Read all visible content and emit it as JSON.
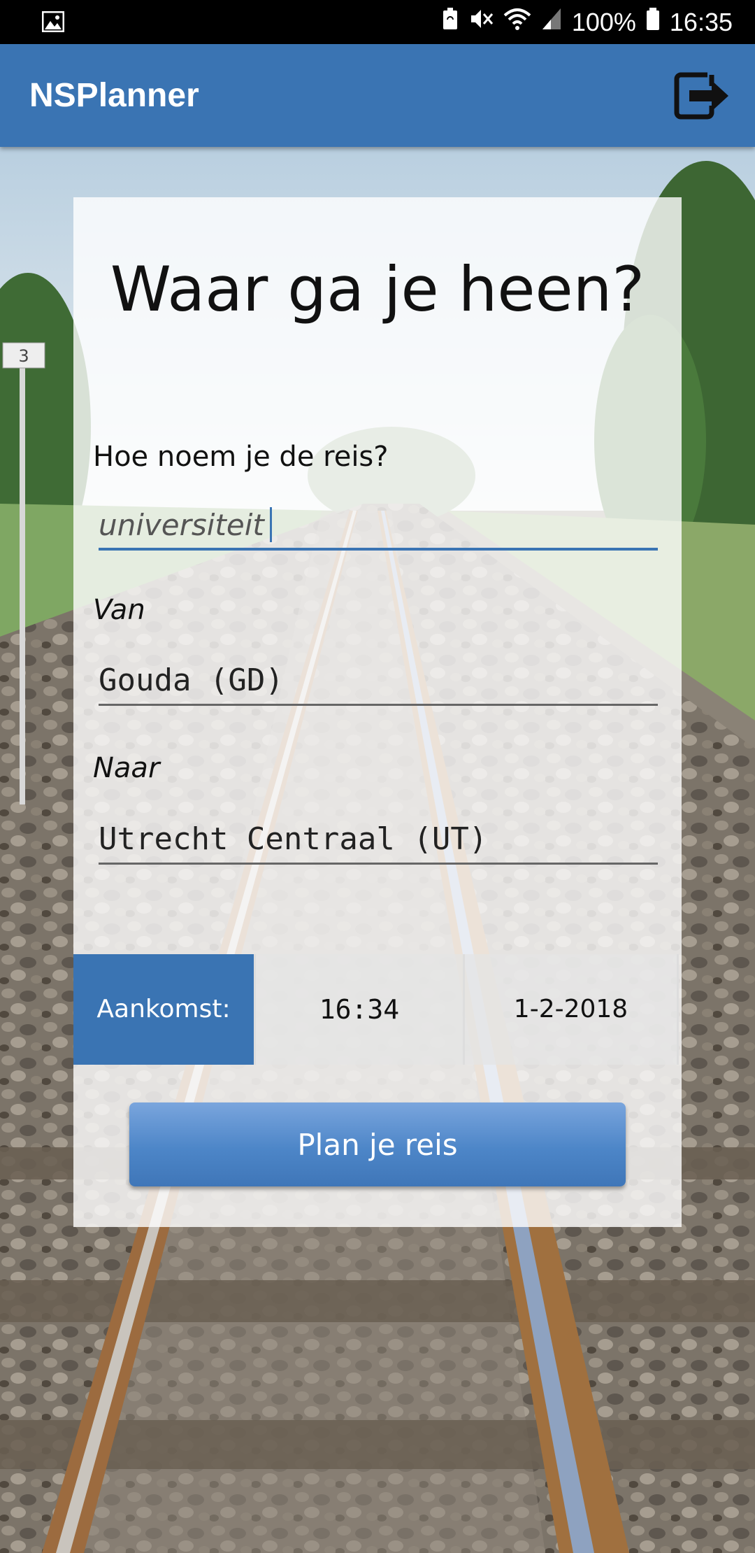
{
  "status_bar": {
    "battery_percent": "100%",
    "time": "16:35",
    "icons": [
      "image-icon",
      "battery-saver-icon",
      "mute-icon",
      "wifi-icon",
      "signal-icon",
      "battery-icon"
    ]
  },
  "app_bar": {
    "title": "NSPlanner",
    "action_icon": "logout-icon",
    "color": "#3a74b3"
  },
  "form": {
    "heading": "Waar ga je heen?",
    "trip_name": {
      "label": "Hoe noem je de reis?",
      "value": "universiteit"
    },
    "from": {
      "label": "Van",
      "value": "Gouda (GD)"
    },
    "to": {
      "label": "Naar",
      "value": "Utrecht Centraal (UT)"
    },
    "time_mode": "Aankomst:",
    "time": "16:34",
    "date": "1-2-2018",
    "submit_label": "Plan je reis"
  }
}
